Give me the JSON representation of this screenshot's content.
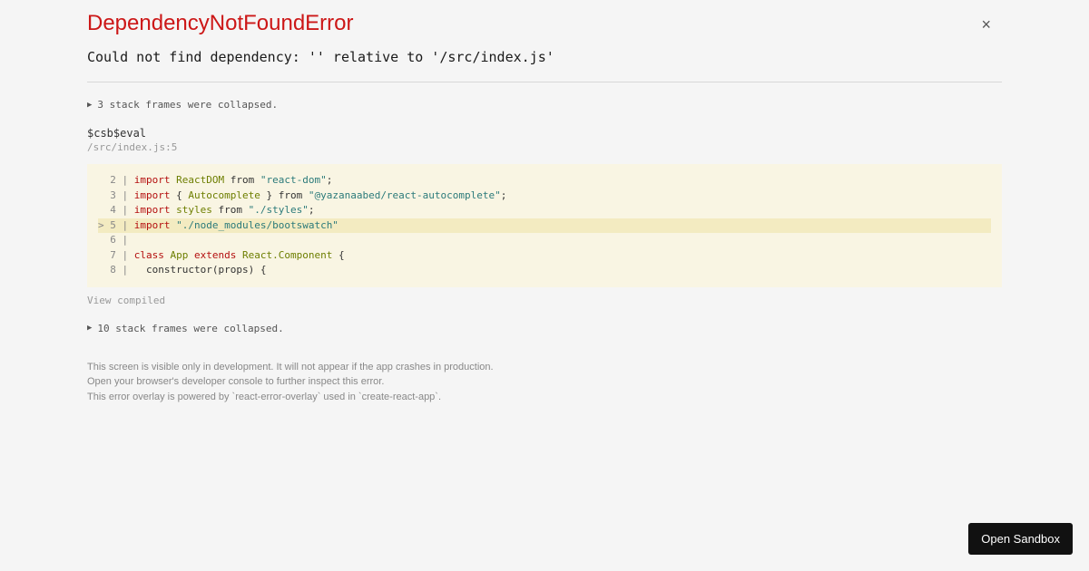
{
  "error": {
    "title": "DependencyNotFoundError",
    "message": "Could not find dependency: '' relative to '/src/index.js'",
    "collapsed_top": "3 stack frames were collapsed.",
    "collapsed_bottom": "10 stack frames were collapsed."
  },
  "frame": {
    "name": "$csb$eval",
    "location": "/src/index.js:5",
    "view_compiled": "View compiled"
  },
  "code": {
    "lines": [
      {
        "gutter": "  2 | ",
        "tokens": [
          [
            "kw",
            "import"
          ],
          [
            "punct",
            " "
          ],
          [
            "ident",
            "ReactDOM"
          ],
          [
            "punct",
            " from "
          ],
          [
            "str",
            "\"react-dom\""
          ],
          [
            "punct",
            ";"
          ]
        ]
      },
      {
        "gutter": "  3 | ",
        "tokens": [
          [
            "kw",
            "import"
          ],
          [
            "punct",
            " { "
          ],
          [
            "ident",
            "Autocomplete"
          ],
          [
            "punct",
            " } from "
          ],
          [
            "str",
            "\"@yazanaabed/react-autocomplete\""
          ],
          [
            "punct",
            ";"
          ]
        ]
      },
      {
        "gutter": "  4 | ",
        "tokens": [
          [
            "kw",
            "import"
          ],
          [
            "punct",
            " "
          ],
          [
            "ident",
            "styles"
          ],
          [
            "punct",
            " from "
          ],
          [
            "str",
            "\"./styles\""
          ],
          [
            "punct",
            ";"
          ]
        ]
      },
      {
        "gutter": "> 5 | ",
        "highlighted": true,
        "tokens": [
          [
            "kw",
            "import"
          ],
          [
            "punct",
            " "
          ],
          [
            "str",
            "\"./node_modules/bootswatch\""
          ]
        ]
      },
      {
        "gutter": "  6 | ",
        "tokens": []
      },
      {
        "gutter": "  7 | ",
        "tokens": [
          [
            "kw",
            "class"
          ],
          [
            "punct",
            " "
          ],
          [
            "ident",
            "App"
          ],
          [
            "punct",
            " "
          ],
          [
            "kw",
            "extends"
          ],
          [
            "punct",
            " "
          ],
          [
            "ident",
            "React.Component"
          ],
          [
            "punct",
            " {"
          ]
        ]
      },
      {
        "gutter": "  8 | ",
        "tokens": [
          [
            "punct",
            "  constructor(props) {"
          ]
        ]
      }
    ]
  },
  "footer": {
    "line1": "This screen is visible only in development. It will not appear if the app crashes in production.",
    "line2": "Open your browser's developer console to further inspect this error.",
    "line3": "This error overlay is powered by `react-error-overlay` used in `create-react-app`."
  },
  "close_label": "×",
  "open_sandbox_label": "Open Sandbox"
}
